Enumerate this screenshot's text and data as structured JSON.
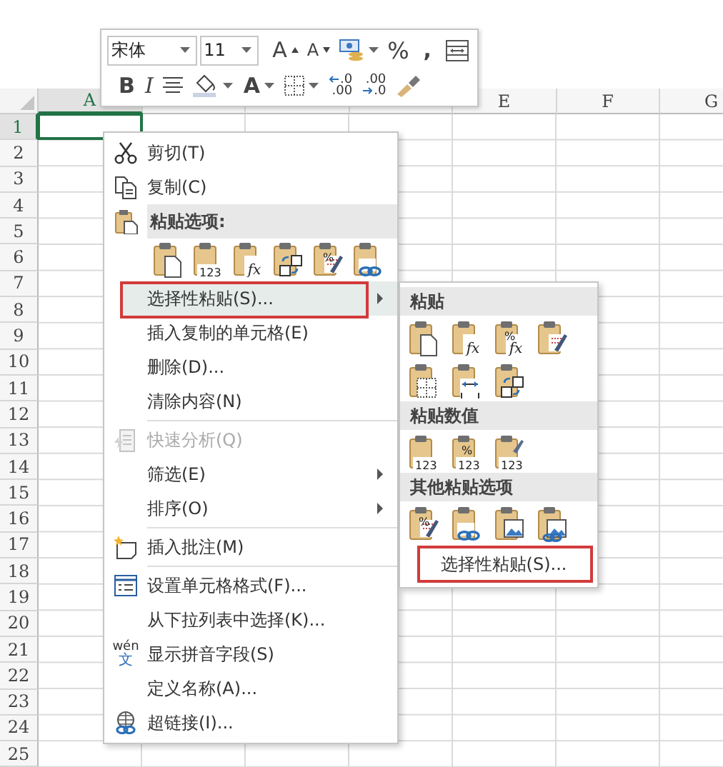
{
  "mini_toolbar": {
    "font": "宋体",
    "size": "11",
    "rows": [
      [
        {
          "kind": "grow_font",
          "text": "A",
          "dropdown": false
        },
        {
          "kind": "shrink_font",
          "text": "A",
          "dropdown": false
        },
        {
          "kind": "accounting",
          "dropdown": true
        },
        {
          "kind": "percent",
          "text": "%",
          "dropdown": false
        },
        {
          "kind": "comma",
          "text": ",",
          "dropdown": false
        },
        {
          "kind": "wrap",
          "dropdown": false
        }
      ],
      [
        {
          "kind": "bold",
          "text": "B",
          "dropdown": false
        },
        {
          "kind": "italic",
          "text": "I",
          "dropdown": false
        },
        {
          "kind": "center",
          "dropdown": false
        },
        {
          "kind": "fill_color",
          "dropdown": true
        },
        {
          "kind": "font_color",
          "text": "A",
          "dropdown": true
        },
        {
          "kind": "borders",
          "dropdown": true
        },
        {
          "kind": "decrease_decimal",
          "top": ".0",
          "bottom": ".00",
          "dropdown": false
        },
        {
          "kind": "increase_decimal",
          "top": ".00",
          "bottom": ".0",
          "dropdown": false
        },
        {
          "kind": "format_painter",
          "dropdown": false
        }
      ]
    ]
  },
  "sheet": {
    "columns": [
      {
        "kind": "header",
        "label": "A",
        "selected": true
      },
      {
        "kind": "covered"
      },
      {
        "kind": "covered"
      },
      {
        "kind": "covered"
      },
      {
        "kind": "header",
        "label": "E",
        "selected": false
      },
      {
        "kind": "header",
        "label": "F",
        "selected": false
      },
      {
        "kind": "header",
        "label": "G",
        "selected": false
      }
    ],
    "rows": [
      {
        "label": "1",
        "selected": true
      },
      {
        "label": "2",
        "selected": false
      },
      {
        "label": "3",
        "selected": false
      },
      {
        "label": "4",
        "selected": false
      },
      {
        "label": "5",
        "selected": false
      },
      {
        "label": "6",
        "selected": false
      },
      {
        "label": "7",
        "selected": false
      },
      {
        "label": "8",
        "selected": false
      },
      {
        "label": "9",
        "selected": false
      },
      {
        "label": "10",
        "selected": false
      },
      {
        "label": "11",
        "selected": false
      },
      {
        "label": "12",
        "selected": false
      },
      {
        "label": "13",
        "selected": false
      },
      {
        "label": "14",
        "selected": false
      },
      {
        "label": "15",
        "selected": false
      },
      {
        "label": "16",
        "selected": false
      },
      {
        "label": "17",
        "selected": false
      },
      {
        "label": "18",
        "selected": false
      },
      {
        "label": "19",
        "selected": false
      },
      {
        "label": "20",
        "selected": false
      },
      {
        "label": "21",
        "selected": false
      },
      {
        "label": "22",
        "selected": false
      },
      {
        "label": "23",
        "selected": false
      },
      {
        "label": "24",
        "selected": false
      },
      {
        "label": "25",
        "selected": false
      }
    ]
  },
  "context_menu": {
    "items": [
      {
        "kind": "item",
        "label": "剪切(T)",
        "disabled": false,
        "submenu": false,
        "selected": false,
        "annotated": false
      },
      {
        "kind": "item",
        "label": "复制(C)",
        "disabled": false,
        "submenu": false,
        "selected": false,
        "annotated": false
      },
      {
        "kind": "header",
        "label": "粘贴选项:"
      },
      {
        "kind": "paste_icons",
        "icons": [
          {
            "kind": "page"
          },
          {
            "kind": "numbers",
            "glyph": "123"
          },
          {
            "kind": "formula",
            "glyph": "fx"
          },
          {
            "kind": "transpose"
          },
          {
            "kind": "brush",
            "glyph_top": "%"
          },
          {
            "kind": "chain"
          }
        ]
      },
      {
        "kind": "item",
        "label": "选择性粘贴(S)...",
        "disabled": false,
        "submenu": true,
        "selected": true,
        "annotated": true
      },
      {
        "kind": "item",
        "label": "插入复制的单元格(E)",
        "disabled": false,
        "submenu": false,
        "selected": false,
        "annotated": false
      },
      {
        "kind": "item",
        "label": "删除(D)...",
        "disabled": false,
        "submenu": false,
        "selected": false,
        "annotated": false
      },
      {
        "kind": "item",
        "label": "清除内容(N)",
        "disabled": false,
        "submenu": false,
        "selected": false,
        "annotated": false
      },
      {
        "kind": "separator"
      },
      {
        "kind": "item",
        "label": "快速分析(Q)",
        "disabled": true,
        "submenu": false,
        "selected": false,
        "annotated": false
      },
      {
        "kind": "item",
        "label": "筛选(E)",
        "disabled": false,
        "submenu": true,
        "selected": false,
        "annotated": false
      },
      {
        "kind": "item",
        "label": "排序(O)",
        "disabled": false,
        "submenu": true,
        "selected": false,
        "annotated": false
      },
      {
        "kind": "separator"
      },
      {
        "kind": "item",
        "label": "插入批注(M)",
        "disabled": false,
        "submenu": false,
        "selected": false,
        "annotated": false
      },
      {
        "kind": "separator"
      },
      {
        "kind": "item",
        "label": "设置单元格格式(F)...",
        "disabled": false,
        "submenu": false,
        "selected": false,
        "annotated": false
      },
      {
        "kind": "item",
        "label": "从下拉列表中选择(K)...",
        "disabled": false,
        "submenu": false,
        "selected": false,
        "annotated": false
      },
      {
        "kind": "item",
        "label": "显示拼音字段(S)",
        "icon_text": [
          "wén",
          "文"
        ],
        "disabled": false,
        "submenu": false,
        "selected": false,
        "annotated": false
      },
      {
        "kind": "item",
        "label": "定义名称(A)...",
        "disabled": false,
        "submenu": false,
        "selected": false,
        "annotated": false
      },
      {
        "kind": "item",
        "label": "超链接(I)...",
        "disabled": false,
        "submenu": false,
        "selected": false,
        "annotated": false
      }
    ]
  },
  "submenu": {
    "sections": [
      {
        "header": "粘贴",
        "rows": [
          [
            {
              "kind": "page"
            },
            {
              "kind": "formula",
              "glyph": "fx"
            },
            {
              "kind": "formula",
              "glyph_top": "%",
              "glyph": "fx"
            },
            {
              "kind": "brush"
            }
          ],
          [
            {
              "kind": "dotted"
            },
            {
              "kind": "width"
            },
            {
              "kind": "transpose"
            }
          ]
        ]
      },
      {
        "header": "粘贴数值",
        "rows": [
          [
            {
              "kind": "numbers",
              "glyph": "123"
            },
            {
              "kind": "numbers",
              "glyph_top": "%",
              "glyph": "123"
            },
            {
              "kind": "numbers_brush",
              "glyph": "123"
            }
          ]
        ]
      },
      {
        "header": "其他粘贴选项",
        "rows": [
          [
            {
              "kind": "brush",
              "glyph_top": "%"
            },
            {
              "kind": "chain"
            },
            {
              "kind": "picture"
            },
            {
              "kind": "linked_picture"
            }
          ]
        ]
      }
    ],
    "footer": {
      "label": "选择性粘贴(S)...",
      "annotated": true
    }
  }
}
